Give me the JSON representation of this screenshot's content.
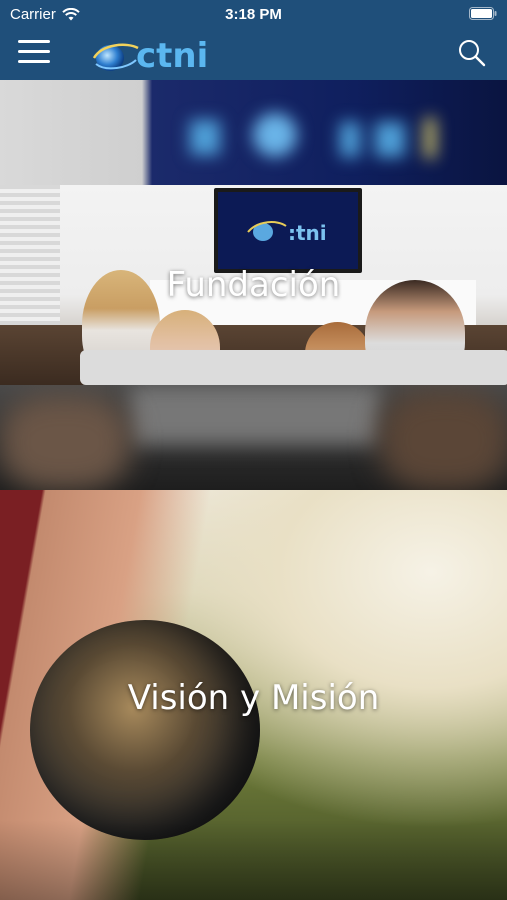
{
  "status_bar": {
    "carrier": "Carrier",
    "time": "3:18 PM",
    "icons": [
      "wifi-icon",
      "battery-icon"
    ]
  },
  "header": {
    "background": "#1f4f7a",
    "logo_text": "ctni",
    "icons": [
      "menu-icon",
      "search-icon"
    ]
  },
  "sections": [
    {
      "title": ""
    },
    {
      "title": "Fundación"
    },
    {
      "title": ""
    },
    {
      "title": "Visión y Misión"
    }
  ]
}
